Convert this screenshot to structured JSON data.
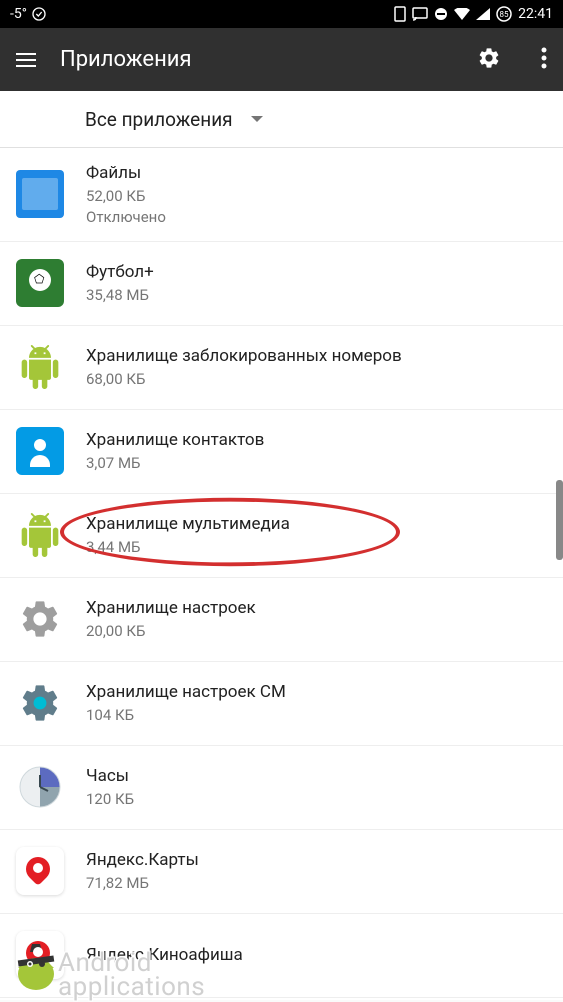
{
  "status": {
    "temp": "-5°",
    "time": "22:41"
  },
  "header": {
    "title": "Приложения"
  },
  "filter": {
    "label": "Все приложения"
  },
  "apps": [
    {
      "name": "Файлы",
      "size": "52,00 КБ",
      "status": "Отключено",
      "icon": "files"
    },
    {
      "name": "Футбол+",
      "size": "35,48 МБ",
      "icon": "football"
    },
    {
      "name": "Хранилище заблокированных номеров",
      "size": "68,00 КБ",
      "icon": "android"
    },
    {
      "name": "Хранилище контактов",
      "size": "3,07 МБ",
      "icon": "contacts"
    },
    {
      "name": "Хранилище мультимедиа",
      "size": "3,44 МБ",
      "icon": "android",
      "highlighted": true
    },
    {
      "name": "Хранилище настроек",
      "size": "20,00 КБ",
      "icon": "gear"
    },
    {
      "name": "Хранилище настроек CM",
      "size": "104 КБ",
      "icon": "gear-cm"
    },
    {
      "name": "Часы",
      "size": "120 КБ",
      "icon": "clock"
    },
    {
      "name": "Яндекс.Карты",
      "size": "71,82 МБ",
      "icon": "yandex"
    },
    {
      "name": "Яндекс.Киноафиша",
      "size": "",
      "icon": "yandex"
    }
  ],
  "watermark": {
    "line1": "Android",
    "line2": "applications"
  }
}
